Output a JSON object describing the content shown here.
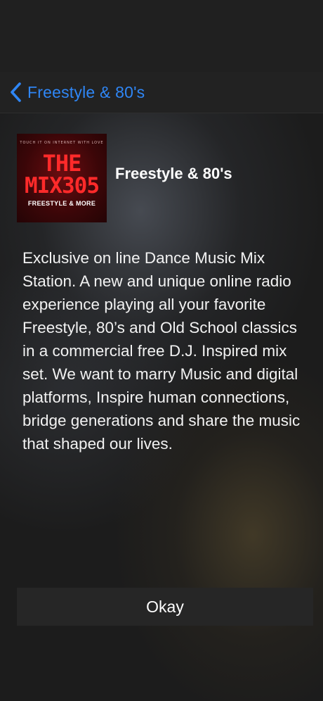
{
  "nav": {
    "back_label": "Freestyle & 80's",
    "accent_color": "#2f86f5"
  },
  "station": {
    "title": "Freestyle & 80's",
    "logo": {
      "tagline": "TOUCH IT ON INTERNET WITH LOVE",
      "line1": "THE",
      "line2": "MIX305",
      "subtitle": "FREESTYLE & MORE"
    },
    "description": "Exclusive on line Dance Music Mix Station. A new and unique online radio experience playing all your favorite Freestyle, 80’s and Old School classics in a commercial free D.J. Inspired mix set. We want to marry Music and digital platforms, Inspire human connections, bridge generations and share the music that shaped our lives."
  },
  "actions": {
    "okay_label": "Okay"
  },
  "icons": {
    "back": "chevron-left-icon"
  }
}
